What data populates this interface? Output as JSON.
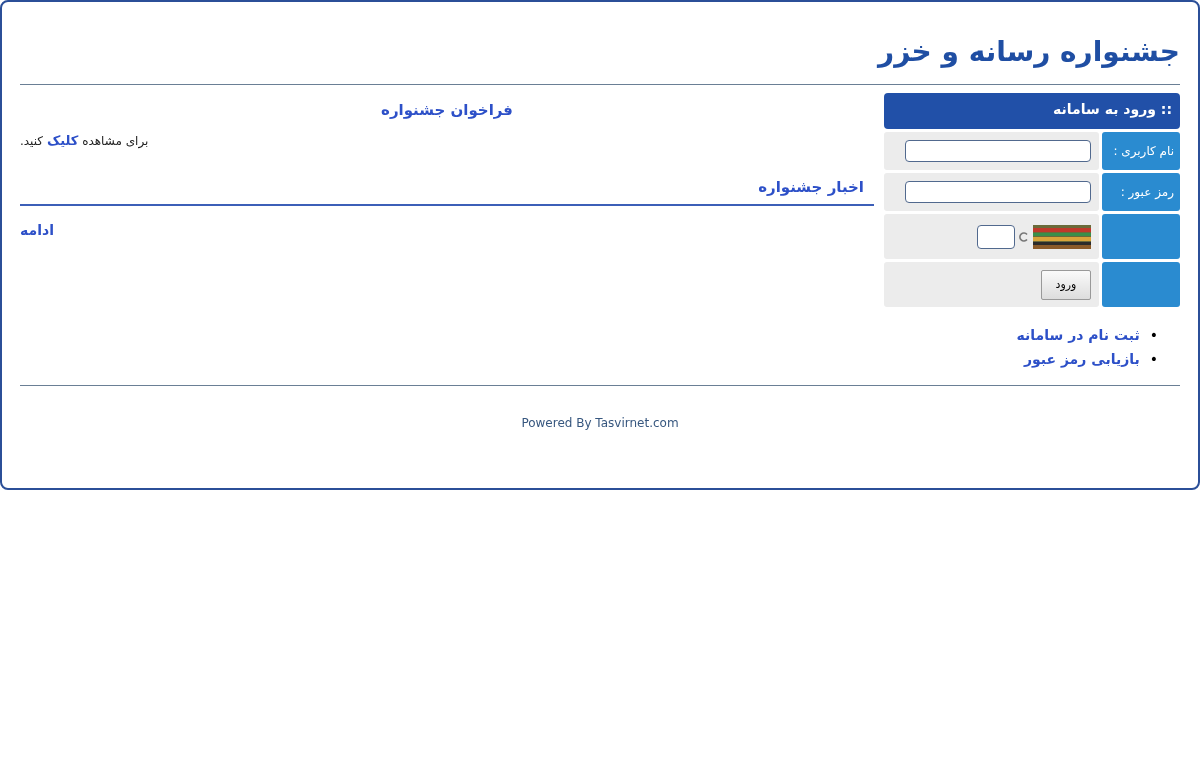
{
  "site_title": "جشنواره رسانه و خزر",
  "login": {
    "title": ":: ورود به سامانه",
    "fields": [
      {
        "label": "نام کاربری :"
      },
      {
        "label": "رمز عبور :"
      }
    ],
    "submit": "ورود"
  },
  "links": [
    {
      "bullet": "•",
      "label": "ثبت نام در سامانه"
    },
    {
      "bullet": "•",
      "label": "بازیابی رمز عبور"
    }
  ],
  "call": {
    "title": "فراخوان جشنواره",
    "before": "برای مشاهده ",
    "link": "کلیک",
    "after": " کنید."
  },
  "news": {
    "title": "اخبار جشنواره",
    "more": "ادامه"
  },
  "footer": "Powered By Tasvirnet.com"
}
